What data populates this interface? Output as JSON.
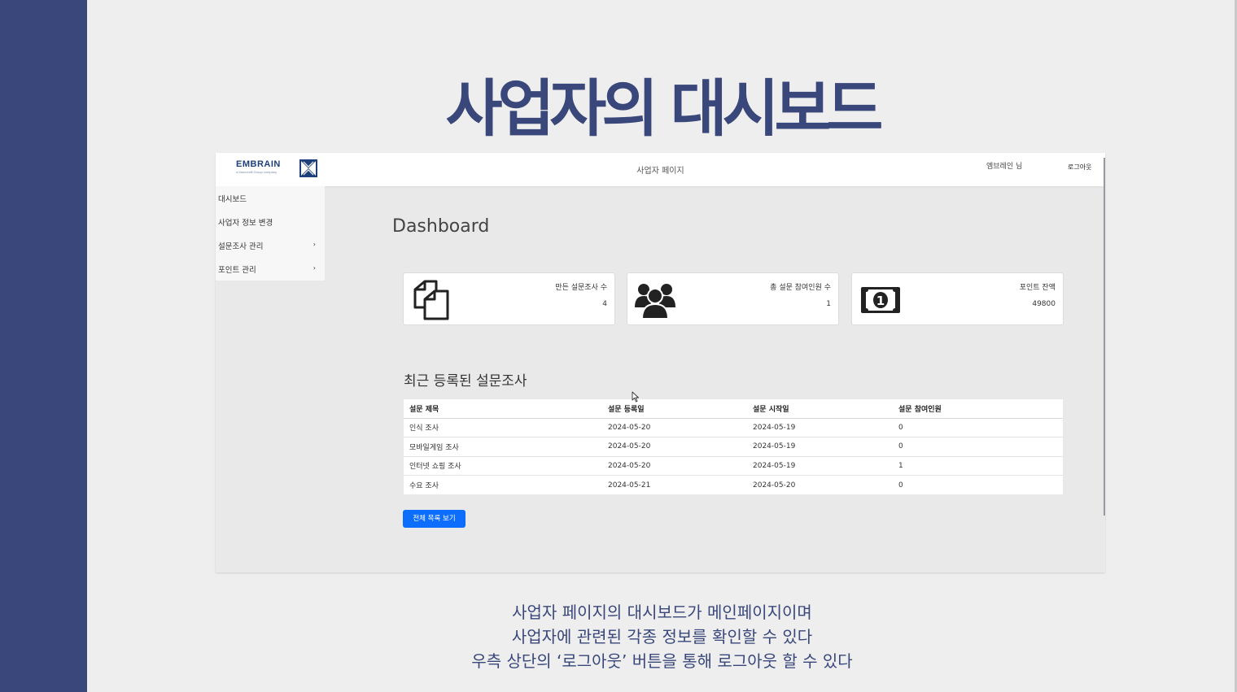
{
  "slide": {
    "title": "사업자의 대시보드",
    "caption_lines": [
      "사업자 페이지의 대시보드가 메인페이지이며",
      "사업자에 관련된 각종 정보를 확인할 수 있다",
      "우측 상단의 ‘로그아웃’ 버튼을 통해 로그아웃 할 수 있다"
    ]
  },
  "header": {
    "logo_text": "EMBRAIN",
    "logo_subtext": "a Macromill Group company",
    "page_label": "사업자 페이지",
    "user_label": "엠브레인 님",
    "logout_label": "로그아웃"
  },
  "sidebar": {
    "items": [
      {
        "label": "대시보드",
        "has_submenu": false
      },
      {
        "label": "사업자 정보 변경",
        "has_submenu": false
      },
      {
        "label": "설문조사 관리",
        "has_submenu": true,
        "arrow": "›"
      },
      {
        "label": "포인트 관리",
        "has_submenu": true,
        "arrow": "›"
      }
    ]
  },
  "main": {
    "title": "Dashboard",
    "cards": [
      {
        "icon": "copy-documents-icon",
        "label": "만든 설문조사 수",
        "value": "4"
      },
      {
        "icon": "users-group-icon",
        "label": "총 설문 참여인원 수",
        "value": "1"
      },
      {
        "icon": "money-bill-icon",
        "label": "포인트 잔액",
        "value": "49800"
      }
    ],
    "recent_title": "최근 등록된 설문조사",
    "table": {
      "columns": [
        "설문 제목",
        "설문 등록일",
        "설문 시작일",
        "설문 참여인원"
      ],
      "rows": [
        [
          "인식 조사",
          "2024-05-20",
          "2024-05-19",
          "0"
        ],
        [
          "모바일게임 조사",
          "2024-05-20",
          "2024-05-19",
          "0"
        ],
        [
          "인터넷 쇼핑 조사",
          "2024-05-20",
          "2024-05-19",
          "1"
        ],
        [
          "수요 조사",
          "2024-05-21",
          "2024-05-20",
          "0"
        ]
      ]
    },
    "view_all_label": "전체 목록 보기"
  },
  "colors": {
    "slide_accent": "#39477a",
    "button_primary": "#0d6efd",
    "logo_blue": "#1e3f7c"
  }
}
